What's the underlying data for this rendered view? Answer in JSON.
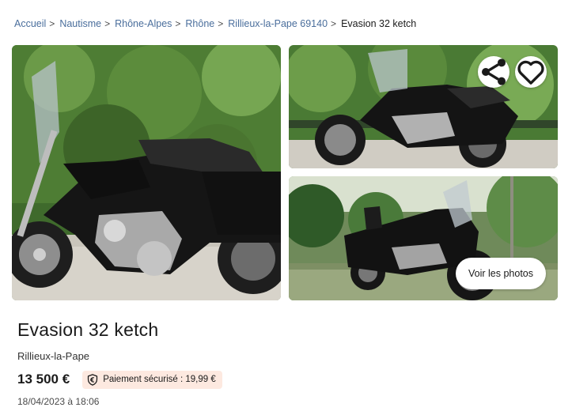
{
  "breadcrumb": {
    "items": [
      {
        "label": "Accueil"
      },
      {
        "label": "Nautisme"
      },
      {
        "label": "Rhône-Alpes"
      },
      {
        "label": "Rhône"
      },
      {
        "label": "Rillieux-la-Pape 69140"
      }
    ],
    "separator": ">",
    "current": "Evasion 32 ketch"
  },
  "gallery": {
    "share_icon": "share-icon",
    "favorite_icon": "heart-icon",
    "see_photos_label": "Voir les photos"
  },
  "listing": {
    "title": "Evasion 32 ketch",
    "location": "Rillieux-la-Pape",
    "price": "13 500 €",
    "secure_payment": "Paiement sécurisé : 19,99 €",
    "secure_icon": "euro-shield-icon",
    "date": "18/04/2023 à 18:06"
  },
  "colors": {
    "link": "#4a6e9c",
    "badge_bg": "#fde9e0"
  }
}
